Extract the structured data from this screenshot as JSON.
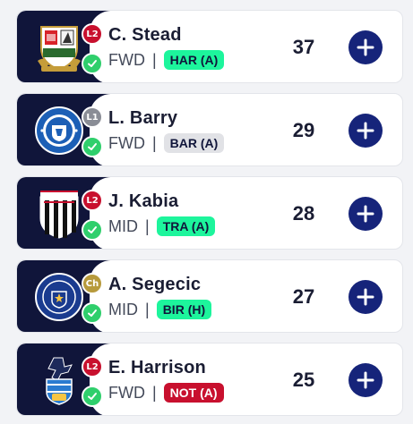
{
  "players": [
    {
      "name": "C. Stead",
      "position": "FWD",
      "fixture": "HAR (A)",
      "fixture_bg": "#1df59c",
      "fixture_fg": "#10153a",
      "league": "L2",
      "league_color": "#c8102e",
      "points": "37",
      "crest": "barnet"
    },
    {
      "name": "L. Barry",
      "position": "FWD",
      "fixture": "BAR (A)",
      "fixture_bg": "#e1e2e6",
      "fixture_fg": "#10153a",
      "league": "L1",
      "league_color": "#8a8d96",
      "points": "29",
      "crest": "stockport"
    },
    {
      "name": "J. Kabia",
      "position": "MID",
      "fixture": "TRA (A)",
      "fixture_bg": "#1df59c",
      "fixture_fg": "#10153a",
      "league": "L2",
      "league_color": "#c8102e",
      "points": "28",
      "crest": "grimsby"
    },
    {
      "name": "A. Segecic",
      "position": "MID",
      "fixture": "BIR (H)",
      "fixture_bg": "#1df59c",
      "fixture_fg": "#10153a",
      "league": "Ch",
      "league_color": "#b79a3c",
      "points": "27",
      "crest": "portsmouth"
    },
    {
      "name": "E. Harrison",
      "position": "FWD",
      "fixture": "NOT (A)",
      "fixture_bg": "#c8102e",
      "fixture_fg": "#ffffff",
      "league": "L2",
      "league_color": "#c8102e",
      "points": "25",
      "crest": "bristol"
    }
  ],
  "separator": "|",
  "colors": {
    "panel": "#10153a",
    "add_button": "#16247a",
    "check": "#2fcf6c"
  }
}
